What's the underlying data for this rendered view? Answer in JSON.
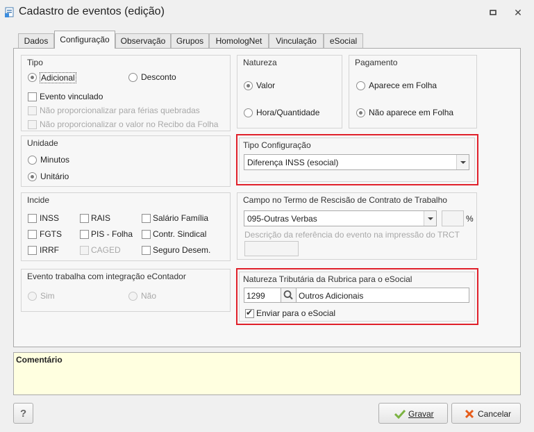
{
  "window": {
    "title": "Cadastro de eventos (edição)"
  },
  "tabs": [
    {
      "label": "Dados"
    },
    {
      "label": "Configuração"
    },
    {
      "label": "Observação"
    },
    {
      "label": "Grupos"
    },
    {
      "label": "HomologNet"
    },
    {
      "label": "Vinculação"
    },
    {
      "label": "eSocial"
    }
  ],
  "tipo": {
    "title": "Tipo",
    "adicional": "Adicional",
    "desconto": "Desconto",
    "evento_vinculado": "Evento vinculado",
    "nao_prop_ferias": "Não proporcionalizar para férias quebradas",
    "nao_prop_recibo": "Não proporcionalizar o valor no Recibo da Folha"
  },
  "natureza": {
    "title": "Natureza",
    "valor": "Valor",
    "hora": "Hora/Quantidade"
  },
  "pagamento": {
    "title": "Pagamento",
    "aparece": "Aparece em Folha",
    "nao_aparece": "Não aparece em Folha"
  },
  "unidade": {
    "title": "Unidade",
    "minutos": "Minutos",
    "unitario": "Unitário"
  },
  "tipo_config": {
    "title": "Tipo Configuração",
    "value": "Diferença INSS (esocial)"
  },
  "incide": {
    "title": "Incide",
    "inss": "INSS",
    "rais": "RAIS",
    "salario_familia": "Salário Família",
    "fgts": "FGTS",
    "pis_folha": "PIS - Folha",
    "contr_sindical": "Contr. Sindical",
    "irrf": "IRRF",
    "caged": "CAGED",
    "seguro_desem": "Seguro Desem."
  },
  "campo_trct": {
    "title": "Campo no Termo de Rescisão de Contrato de Trabalho",
    "value": "095-Outras Verbas",
    "percent": "%",
    "desc_label": "Descrição da referência do evento na impressão do TRCT"
  },
  "econtador": {
    "title": "Evento trabalha com integração eContador",
    "sim": "Sim",
    "nao": "Não"
  },
  "natureza_trib": {
    "title": "Natureza Tributária da Rubrica para o eSocial",
    "code": "1299",
    "description": "Outros Adicionais",
    "enviar": "Enviar para o eSocial"
  },
  "comment": {
    "title": "Comentário"
  },
  "buttons": {
    "help": "?",
    "gravar": "Gravar",
    "cancelar": "Cancelar"
  },
  "colors": {
    "highlight": "#e0202a",
    "comment_bg": "#ffffe0",
    "check_green": "#7cb342",
    "cancel_orange": "#e65c1a"
  }
}
